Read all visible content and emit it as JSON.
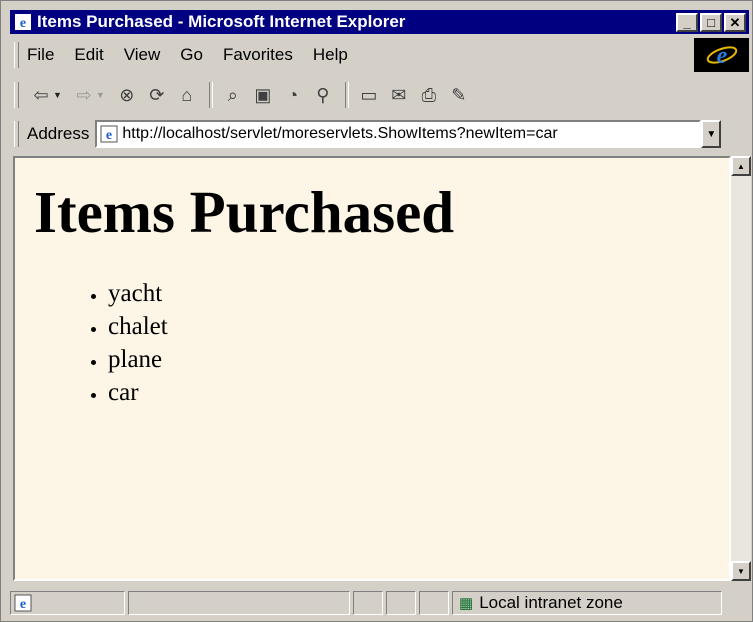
{
  "window": {
    "title": "Items Purchased - Microsoft Internet Explorer",
    "controls": [
      "minimize",
      "maximize",
      "close"
    ]
  },
  "menubar": {
    "items": [
      {
        "label": "File"
      },
      {
        "label": "Edit"
      },
      {
        "label": "View"
      },
      {
        "label": "Go"
      },
      {
        "label": "Favorites"
      },
      {
        "label": "Help"
      }
    ]
  },
  "toolbar": {
    "buttons": [
      "back-icon",
      "forward-icon",
      "stop-icon",
      "refresh-icon",
      "home-icon",
      "search-icon",
      "favorites-icon",
      "history-icon",
      "channels-icon",
      "fullscreen-icon",
      "mail-icon",
      "print-icon",
      "edit-icon"
    ]
  },
  "address": {
    "label": "Address",
    "url": "http://localhost/servlet/moreservlets.ShowItems?newItem=car"
  },
  "page": {
    "heading": "Items Purchased",
    "items": [
      "yacht",
      "chalet",
      "plane",
      "car"
    ],
    "background": "#fdf5e6"
  },
  "statusbar": {
    "zone": "Local intranet zone"
  },
  "colors": {
    "titlebar": "#000080",
    "chrome": "#d4d0c8"
  }
}
